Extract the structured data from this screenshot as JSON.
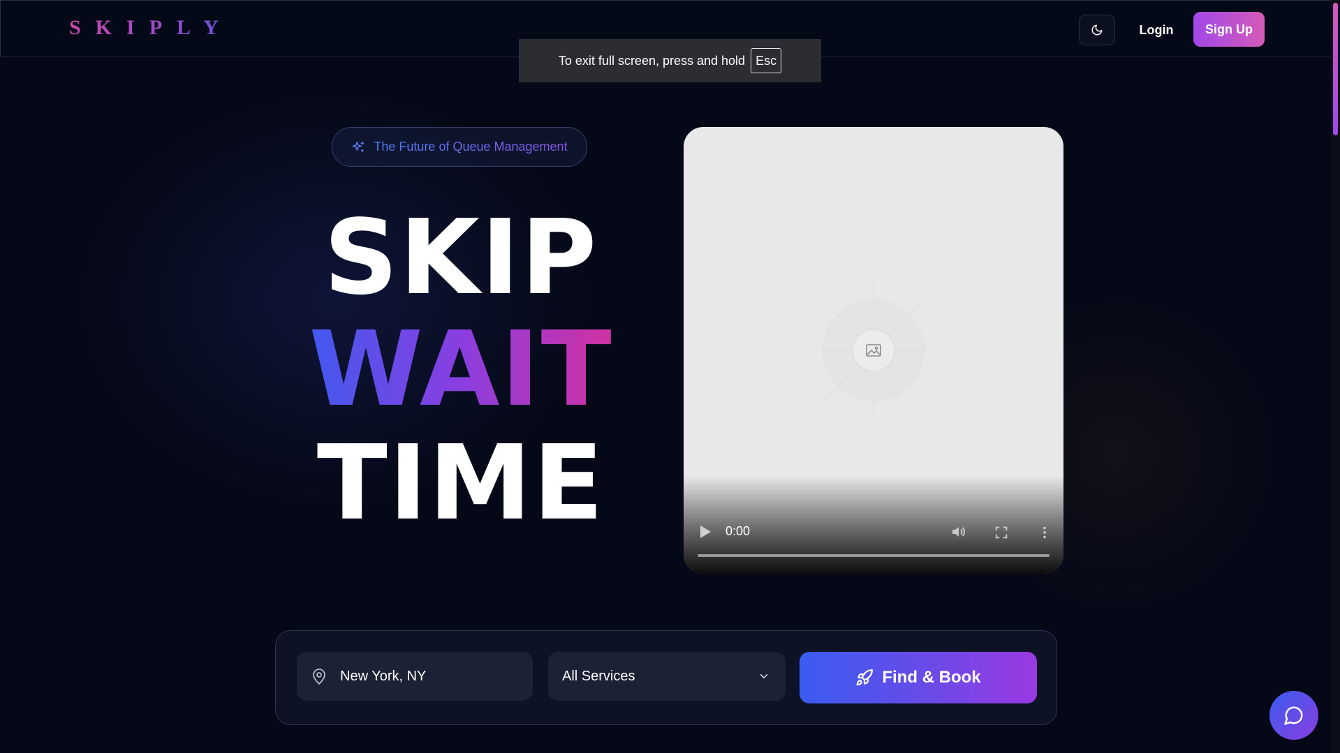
{
  "brand": {
    "logo_text": "SKIPLY"
  },
  "header": {
    "theme_toggle_icon": "moon-icon",
    "login_label": "Login",
    "signup_label": "Sign Up"
  },
  "fullscreen_notice": {
    "text": "To exit full screen, press and hold",
    "key": "Esc"
  },
  "hero": {
    "badge_text": "The Future of Queue Management",
    "badge_icon": "sparkles-icon",
    "line1": "SKIP",
    "line2": "WAIT",
    "line3": "TIME"
  },
  "video": {
    "time": "0:00",
    "progress": 0
  },
  "search": {
    "location_value": "New York, NY",
    "service_selected": "All Services",
    "submit_label": "Find & Book",
    "submit_icon": "rocket-icon"
  },
  "chat": {
    "icon": "chat-bubble-icon"
  },
  "colors": {
    "background": "#050917",
    "accent_blue": "#3a5cf0",
    "accent_purple": "#8a3ee0",
    "accent_pink": "#d8309a"
  }
}
